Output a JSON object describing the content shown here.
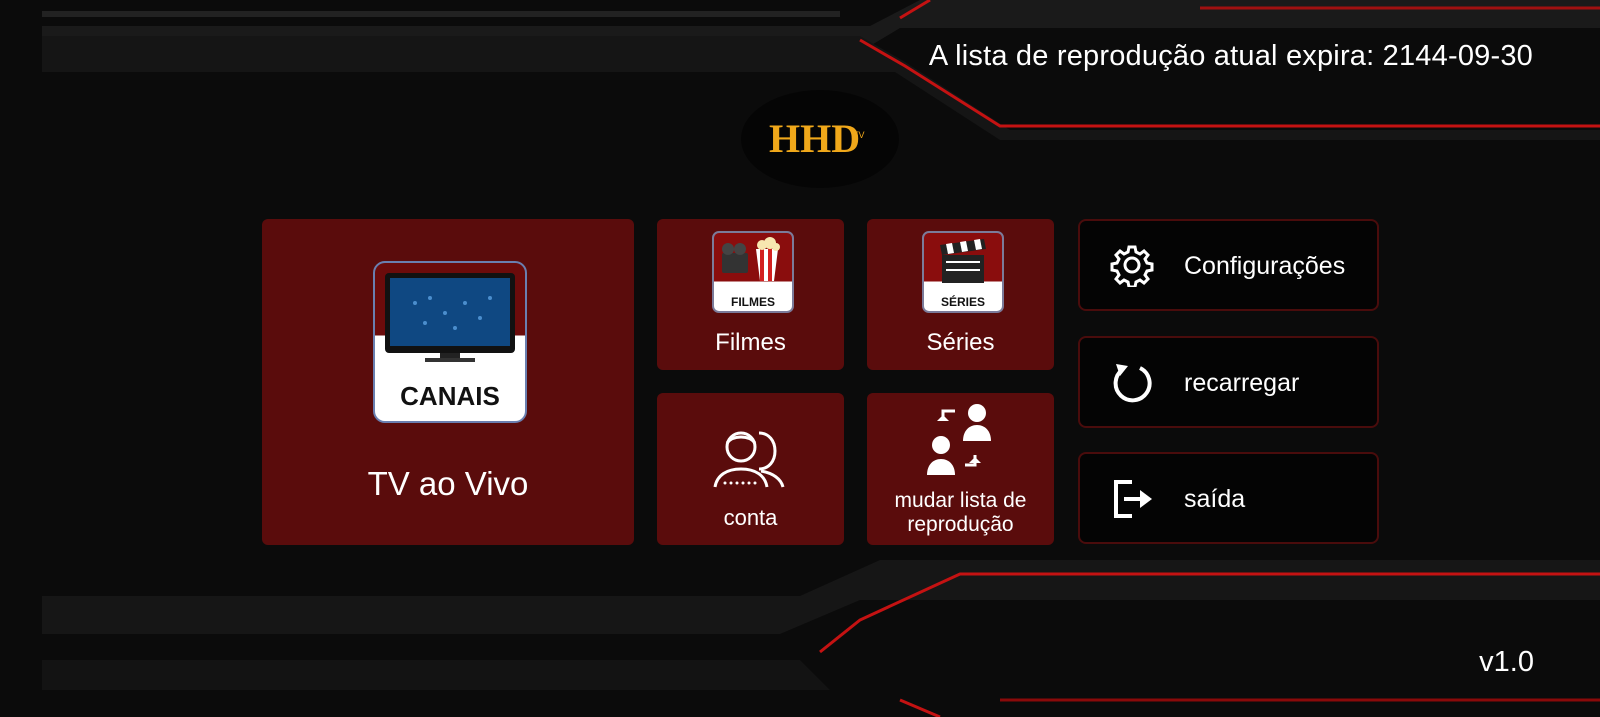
{
  "header": {
    "expiry_text": "A lista de reprodução atual expira: 2144-09-30"
  },
  "logo": {
    "name": "hhd-tv-logo",
    "text": "HHD",
    "subtext": "TV"
  },
  "tiles": {
    "live": {
      "label": "TV ao Vivo",
      "icon_caption": "CANAIS"
    },
    "filmes": {
      "label": "Filmes",
      "icon_caption": "FILMES"
    },
    "series": {
      "label": "Séries",
      "icon_caption": "SÉRIES"
    },
    "conta": {
      "label": "conta"
    },
    "mudar": {
      "label": "mudar lista de reprodução"
    }
  },
  "side_buttons": {
    "config": {
      "label": "Configurações",
      "icon": "gear-icon"
    },
    "reload": {
      "label": "recarregar",
      "icon": "refresh-icon"
    },
    "exit": {
      "label": "saída",
      "icon": "exit-icon"
    }
  },
  "footer": {
    "version": "v1.0"
  },
  "colors": {
    "tile_bg": "#5a0c0c",
    "accent_red": "#b01010",
    "logo_gold": "#f0a81a",
    "background": "#0a0a0a"
  }
}
